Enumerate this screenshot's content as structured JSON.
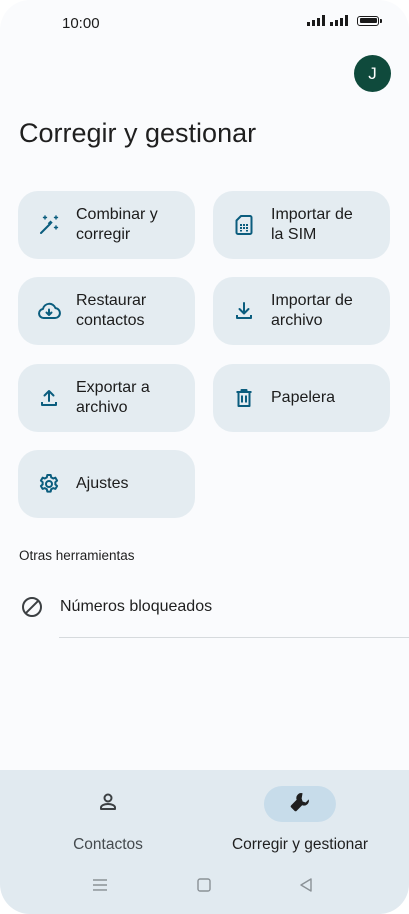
{
  "status_bar": {
    "time": "10:00"
  },
  "account": {
    "initial": "J"
  },
  "page_title": "Corregir y gestionar",
  "tiles": [
    {
      "label": "Combinar y\ncorregir",
      "icon": "magic-wand-icon"
    },
    {
      "label": "Importar de\nla SIM",
      "icon": "sim-card-icon"
    },
    {
      "label": "Restaurar\ncontactos",
      "icon": "cloud-download-icon"
    },
    {
      "label": "Importar de\narchivo",
      "icon": "download-icon"
    },
    {
      "label": "Exportar a\narchivo",
      "icon": "upload-icon"
    },
    {
      "label": "Papelera",
      "icon": "trash-icon"
    },
    {
      "label": "Ajustes",
      "icon": "gear-icon"
    }
  ],
  "other_tools": {
    "section_label": "Otras herramientas",
    "items": [
      {
        "label": "Números bloqueados",
        "icon": "block-icon"
      }
    ]
  },
  "bottom_nav": {
    "items": [
      {
        "label": "Contactos",
        "icon": "person-icon",
        "active": false
      },
      {
        "label": "Corregir y gestionar",
        "icon": "wrench-icon",
        "active": true
      }
    ]
  },
  "colors": {
    "accent": "#0b5d7e",
    "tile_bg": "#e4ecf1",
    "avatar_bg": "#0f4a3c",
    "nav_bg": "#e1eaf0",
    "active_pill": "#c7dcea"
  }
}
